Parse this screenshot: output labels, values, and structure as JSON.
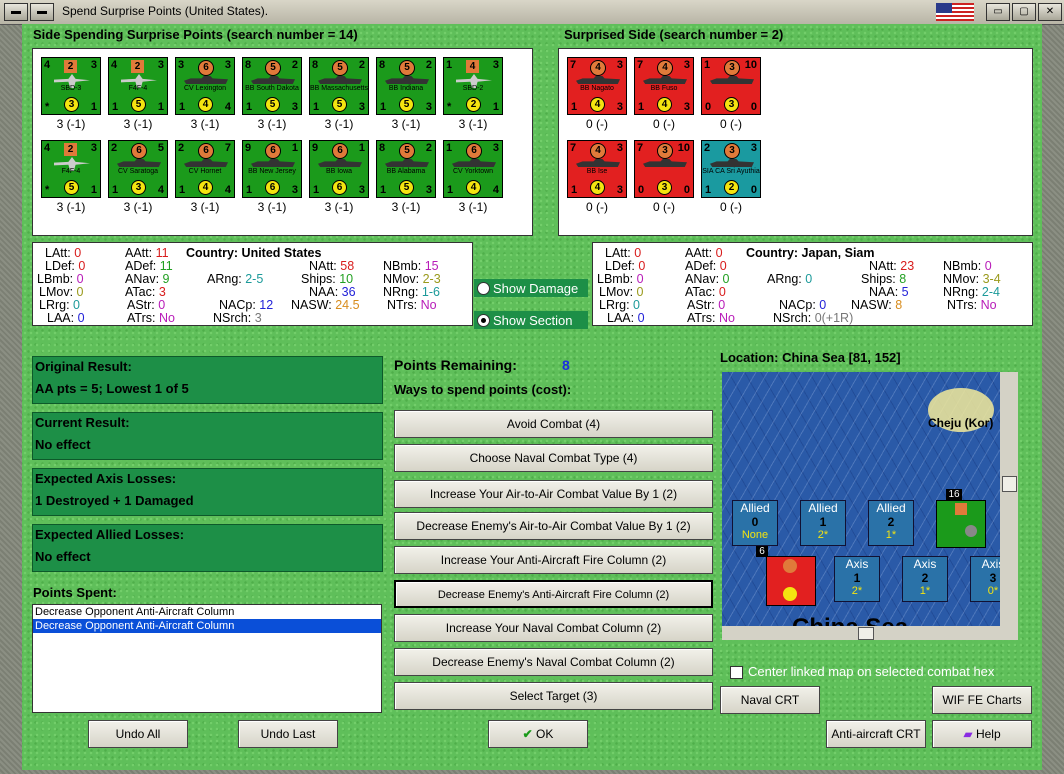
{
  "window": {
    "title": "Spend Surprise Points (United States)."
  },
  "left_header": "Side Spending Surprise Points (search number = 14)",
  "right_header": "Surprised Side (search number = 2)",
  "spending_units": [
    {
      "tl": "4",
      "sq": "2",
      "tr": "3",
      "name": "SBD-3",
      "bl": "*",
      "bc": "3",
      "br": "1",
      "label": "3 (-1)",
      "kind": "plane"
    },
    {
      "tl": "4",
      "sq": "2",
      "tr": "3",
      "name": "F4F-4",
      "bl": "1",
      "bc": "5",
      "br": "1",
      "label": "3 (-1)",
      "kind": "plane"
    },
    {
      "tl": "3",
      "sq": "6",
      "tr": "3",
      "name": "CV Lexington",
      "bl": "1",
      "bc": "4",
      "br": "4",
      "label": "3 (-1)",
      "kind": "ship"
    },
    {
      "tl": "8",
      "sq": "5",
      "tr": "2",
      "name": "BB South Dakota",
      "bl": "1",
      "bc": "5",
      "br": "3",
      "label": "3 (-1)",
      "kind": "ship"
    },
    {
      "tl": "8",
      "sq": "5",
      "tr": "2",
      "name": "BB Massachusetts",
      "bl": "1",
      "bc": "5",
      "br": "3",
      "label": "3 (-1)",
      "kind": "ship"
    },
    {
      "tl": "8",
      "sq": "5",
      "tr": "2",
      "name": "BB Indiana",
      "bl": "1",
      "bc": "5",
      "br": "3",
      "label": "3 (-1)",
      "kind": "ship"
    },
    {
      "tl": "1",
      "sq": "4",
      "tr": "3",
      "name": "SBD-2",
      "bl": "*",
      "bc": "2",
      "br": "1",
      "label": "3 (-1)",
      "kind": "plane"
    },
    {
      "tl": "4",
      "sq": "2",
      "tr": "3",
      "name": "F4F-4",
      "bl": "*",
      "bc": "5",
      "br": "1",
      "label": "3 (-1)",
      "kind": "plane"
    },
    {
      "tl": "2",
      "sq": "6",
      "tr": "5",
      "name": "CV Saratoga",
      "bl": "1",
      "bc": "3",
      "br": "4",
      "label": "3 (-1)",
      "kind": "ship"
    },
    {
      "tl": "2",
      "sq": "6",
      "tr": "7",
      "name": "CV Hornet",
      "bl": "1",
      "bc": "4",
      "br": "4",
      "label": "3 (-1)",
      "kind": "ship"
    },
    {
      "tl": "9",
      "sq": "6",
      "tr": "1",
      "name": "BB New Jersey",
      "bl": "1",
      "bc": "6",
      "br": "3",
      "label": "3 (-1)",
      "kind": "ship"
    },
    {
      "tl": "9",
      "sq": "6",
      "tr": "1",
      "name": "BB Iowa",
      "bl": "1",
      "bc": "6",
      "br": "3",
      "label": "3 (-1)",
      "kind": "ship"
    },
    {
      "tl": "8",
      "sq": "5",
      "tr": "2",
      "name": "BB Alabama",
      "bl": "1",
      "bc": "5",
      "br": "3",
      "label": "3 (-1)",
      "kind": "ship"
    },
    {
      "tl": "1",
      "sq": "6",
      "tr": "3",
      "name": "CV Yorktown",
      "bl": "1",
      "bc": "4",
      "br": "4",
      "label": "3 (-1)",
      "kind": "ship"
    }
  ],
  "surprised_units": [
    {
      "tl": "7",
      "sq": "4",
      "tr": "3",
      "name": "BB Nagato",
      "bl": "1",
      "bc": "4",
      "br": "3",
      "label": "0 (-)",
      "color": "r"
    },
    {
      "tl": "7",
      "sq": "4",
      "tr": "3",
      "name": "BB Fuso",
      "bl": "1",
      "bc": "4",
      "br": "3",
      "label": "0 (-)",
      "color": "r"
    },
    {
      "tl": "1",
      "sq": "3",
      "tr": "10",
      "name": "",
      "bl": "0",
      "bc": "3",
      "br": "0",
      "label": "0 (-)",
      "color": "r"
    },
    {
      "tl": "7",
      "sq": "4",
      "tr": "3",
      "name": "BB Ise",
      "bl": "1",
      "bc": "4",
      "br": "3",
      "label": "0 (-)",
      "color": "r"
    },
    {
      "tl": "7",
      "sq": "3",
      "tr": "10",
      "name": "",
      "bl": "0",
      "bc": "3",
      "br": "0",
      "label": "0 (-)",
      "color": "r"
    },
    {
      "tl": "2",
      "sq": "3",
      "tr": "3",
      "name": "SIA CA Sri Ayuthia",
      "bl": "1",
      "bc": "2",
      "br": "0",
      "label": "0 (-)",
      "color": "t"
    }
  ],
  "us_stats": {
    "country": "Country: United States",
    "latt": "0",
    "aatt": "11",
    "natt": "58",
    "nbmb": "15",
    "ldef": "0",
    "adef": "11",
    "ships": "10",
    "nmov": "2-3",
    "lbmb": "0",
    "anav": "9",
    "arng": "2-5",
    "naa": "36",
    "nrng": "1-6",
    "lmov": "0",
    "atac": "3",
    "nasw": "24.5",
    "ntrs": "No",
    "lrrg": "0",
    "astr": "0",
    "nacp": "12",
    "laa": "0",
    "atrs": "No",
    "nsrch": "3"
  },
  "jp_stats": {
    "country": "Country: Japan, Siam",
    "latt": "0",
    "aatt": "0",
    "natt": "23",
    "nbmb": "0",
    "ldef": "0",
    "adef": "0",
    "ships": "8",
    "nmov": "3-4",
    "lbmb": "0",
    "anav": "0",
    "arng": "0",
    "naa": "5",
    "nrng": "2-4",
    "lmov": "0",
    "atac": "0",
    "nasw": "8",
    "ntrs": "No",
    "lrrg": "0",
    "astr": "0",
    "nacp": "0",
    "laa": "0",
    "atrs": "No",
    "nsrch": "0(+1R)"
  },
  "show_damage": "Show Damage",
  "show_section": "Show Section",
  "results": [
    {
      "title": "Original Result:",
      "value": "AA pts = 5; Lowest 1 of 5"
    },
    {
      "title": "Current Result:",
      "value": "No effect"
    },
    {
      "title": "Expected Axis Losses:",
      "value": "1 Destroyed + 1 Damaged"
    },
    {
      "title": "Expected Allied Losses:",
      "value": "No effect"
    }
  ],
  "points_spent_label": "Points Spent:",
  "points_spent": [
    "Decrease Opponent Anti-Aircraft Column",
    "Decrease Opponent Anti-Aircraft Column"
  ],
  "points_remaining_label": "Points Remaining:",
  "points_remaining": "8",
  "ways_label": "Ways to spend points (cost):",
  "options": [
    "Avoid Combat (4)",
    "Choose Naval Combat Type (4)",
    "Increase Your Air-to-Air Combat Value By 1 (2)",
    "Decrease Enemy's Air-to-Air Combat Value By 1 (2)",
    "Increase Your Anti-Aircraft Fire Column (2)",
    "Decrease Enemy's Anti-Aircraft Fire Column (2)",
    "Increase Your Naval Combat Column (2)",
    "Decrease Enemy's Naval Combat Column (2)",
    "Select Target (3)"
  ],
  "location": "Location: China Sea [81, 152]",
  "map": {
    "island": "Cheju (Kor)",
    "sea": "China Sea",
    "allied": [
      {
        "t": "Allied",
        "n": "0",
        "s": "None"
      },
      {
        "t": "Allied",
        "n": "1",
        "s": "2*"
      },
      {
        "t": "Allied",
        "n": "2",
        "s": "1*"
      }
    ],
    "axis": [
      {
        "t": "Axis",
        "n": "1",
        "s": "2*"
      },
      {
        "t": "Axis",
        "n": "2",
        "s": "1*"
      },
      {
        "t": "Axis",
        "n": "3",
        "s": "0*"
      }
    ],
    "stack_us": "16",
    "stack_jp": "6"
  },
  "center_linked": "Center linked map on selected combat hex",
  "buttons": {
    "naval_crt": "Naval CRT",
    "wif_charts": "WIF FE Charts",
    "aa_crt": "Anti-aircraft CRT",
    "help": "Help",
    "undo_all": "Undo All",
    "undo_last": "Undo Last",
    "ok": "OK"
  }
}
